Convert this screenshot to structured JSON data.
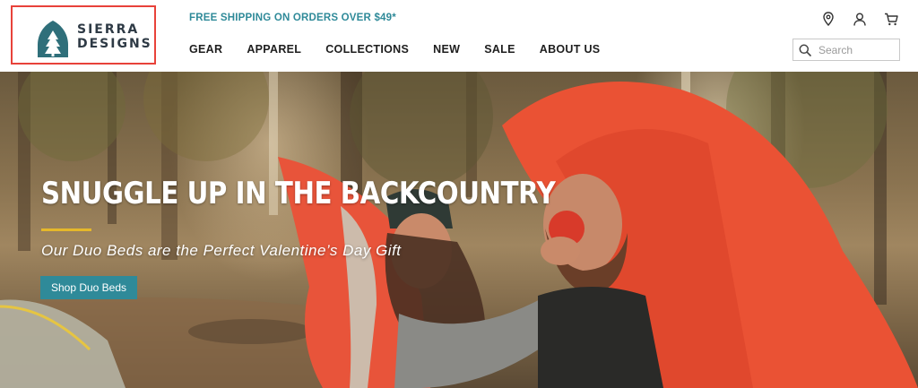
{
  "brand": {
    "name_line1": "SIERRA",
    "name_line2": "DESIGNS",
    "logo_color": "#2f6f7a",
    "highlight_border": "#e8423a"
  },
  "header": {
    "promo": "FREE SHIPPING ON ORDERS OVER $49*",
    "nav": [
      {
        "label": "GEAR"
      },
      {
        "label": "APPAREL"
      },
      {
        "label": "COLLECTIONS"
      },
      {
        "label": "NEW"
      },
      {
        "label": "SALE"
      },
      {
        "label": "ABOUT US"
      }
    ],
    "icons": [
      "location-pin-icon",
      "account-icon",
      "cart-icon"
    ],
    "search": {
      "placeholder": "Search",
      "value": ""
    }
  },
  "hero": {
    "title": "SNUGGLE UP IN THE BACKCOUNTRY",
    "subtitle": "Our Duo Beds are the Perfect Valentine’s Day Gift",
    "cta": "Shop Duo Beds",
    "accent": "#e6b82a",
    "cta_color": "#2f8a99"
  }
}
